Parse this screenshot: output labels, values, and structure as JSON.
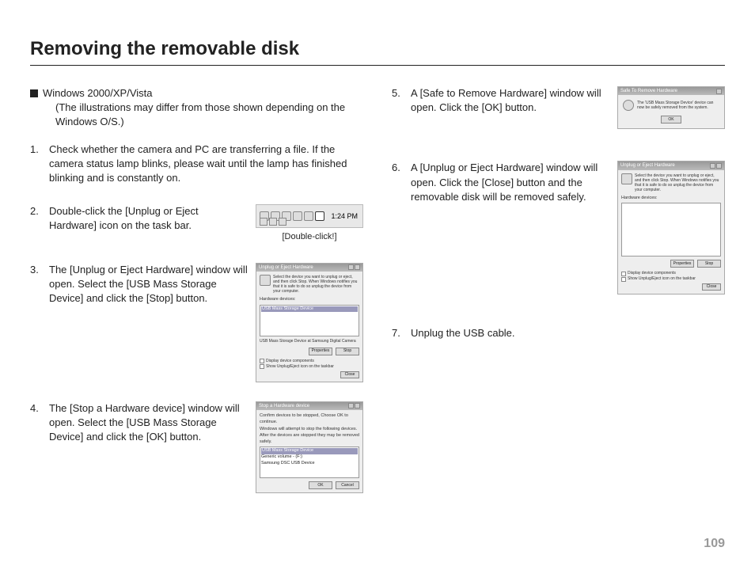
{
  "title": "Removing the removable disk",
  "page_number": "109",
  "intro": {
    "heading": "Windows 2000/XP/Vista",
    "note": "(The illustrations may differ from those shown depending on the Windows O/S.)"
  },
  "left_steps": [
    {
      "num": "1.",
      "text": "Check whether the camera and PC are transferring a file. If the camera status lamp blinks, please wait until the lamp has finished blinking and is constantly on."
    },
    {
      "num": "2.",
      "text": "Double-click the [Unplug or Eject Hardware] icon on the task bar."
    },
    {
      "num": "3.",
      "text": "The [Unplug or Eject Hardware] window will open. Select the [USB Mass Storage Device] and click the [Stop] button."
    },
    {
      "num": "4.",
      "text": "The [Stop a Hardware device] window will open. Select the [USB Mass Storage Device] and click the [OK] button."
    }
  ],
  "right_steps": [
    {
      "num": "5.",
      "text": "A [Safe to Remove Hardware] window will open. Click the [OK] button."
    },
    {
      "num": "6.",
      "text": "A [Unplug or Eject Hardware] window will open. Click the [Close] button and the removable disk will be removed safely."
    },
    {
      "num": "7.",
      "text": "Unplug the USB cable."
    }
  ],
  "taskbar": {
    "clock": "1:24 PM",
    "caption": "[Double-click!]"
  },
  "dialog3": {
    "title": "Unplug or Eject Hardware",
    "info": "Select the device you want to unplug or eject, and then click Stop. When Windows notifies you that it is safe to do so unplug the device from your computer.",
    "section_label": "Hardware devices:",
    "list_item": "USB Mass Storage Device",
    "sublabel": "USB Mass Storage Device at Samsung Digital Camera",
    "btn_props": "Properties",
    "btn_stop": "Stop",
    "check1": "Display device components",
    "check2": "Show Unplug/Eject icon on the taskbar",
    "btn_close": "Close"
  },
  "dialog4": {
    "title": "Stop a Hardware device",
    "info": "Confirm devices to be stopped, Choose OK to continue.",
    "info2": "Windows will attempt to stop the following devices. After the devices are stopped they may be removed safely.",
    "list_item1": "USB Mass Storage Device",
    "list_item2": "Generic volume - (F:)",
    "list_item3": "Samsung DSC USB Device",
    "btn_ok": "OK",
    "btn_cancel": "Cancel"
  },
  "dialog5": {
    "title": "Safe To Remove Hardware",
    "text": "The 'USB Mass Storage Device' device can now be safely removed from the system.",
    "btn_ok": "OK"
  },
  "dialog6": {
    "title": "Unplug or Eject Hardware",
    "info": "Select the device you want to unplug or eject, and then click Stop. When Windows notifies you that it is safe to do so unplug the device from your computer.",
    "section_label": "Hardware devices:",
    "btn_props": "Properties",
    "btn_stop": "Stop",
    "check1": "Display device components",
    "check2": "Show Unplug/Eject icon on the taskbar",
    "btn_close": "Close"
  }
}
